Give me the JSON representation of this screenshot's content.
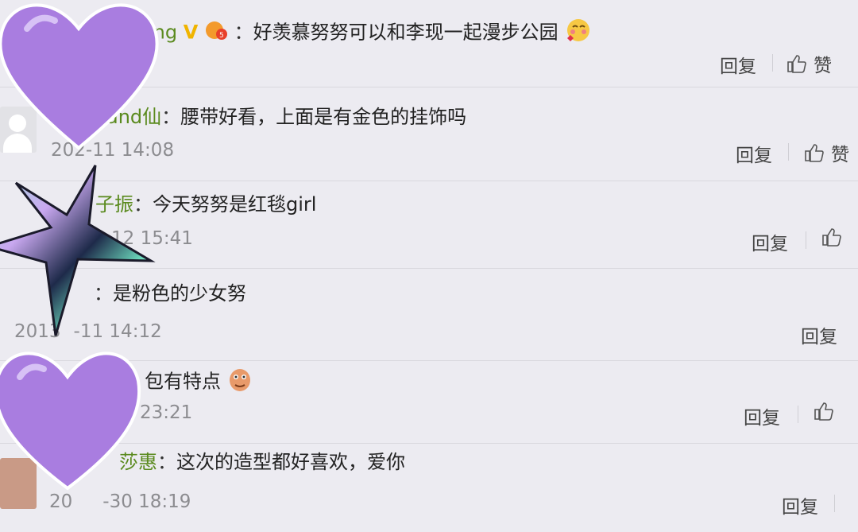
{
  "comments": [
    {
      "user": "ing",
      "colon": "：",
      "text": "好羡慕努努可以和李现一起漫步公园",
      "time": "",
      "reply": "回复",
      "like": "赞",
      "v_badge": "V"
    },
    {
      "user": "and仙",
      "colon": "：",
      "text": "腰带好看，上面是有金色的挂饰吗",
      "time": "2-11 14:08",
      "reply": "回复",
      "like": "赞"
    },
    {
      "user": "子振",
      "colon": "：",
      "text": "今天努努是红毯girl",
      "time": "12 15:41",
      "reply": "回复",
      "like": ""
    },
    {
      "user": "",
      "colon": "：",
      "text": "是粉色的少女努",
      "time": "-11 14:12",
      "reply": "回复",
      "like": ""
    },
    {
      "user": "",
      "colon": "",
      "text": "包有特点",
      "time": "23:21",
      "reply": "回复",
      "like": ""
    },
    {
      "user": "莎惠",
      "colon": "：",
      "text": "这次的造型都好喜欢，爱你",
      "time": "30 18:19",
      "reply": "回复",
      "like": ""
    }
  ],
  "time_fragments": {
    "row1_prefix": "20",
    "row4_prefix": "2013",
    "row6_prefix": "20",
    "row6_mid": "-30 18:19"
  },
  "icons": {
    "like": "thumbs-up-icon",
    "avatar": "default-avatar-icon",
    "emoji_kiss": "blush-kiss-emoji-icon",
    "emoji_cat": "cat-paw-emoji-icon",
    "emoji_badge": "level-badge-icon",
    "stickers": [
      "purple-heart-sticker",
      "holographic-star-sticker",
      "purple-heart-sticker"
    ]
  },
  "colors": {
    "background": "#ecebf1",
    "username": "#5a8a1e",
    "time": "#8c8c90",
    "heart": "#a97de0",
    "vip_badge": "#f0b400"
  }
}
